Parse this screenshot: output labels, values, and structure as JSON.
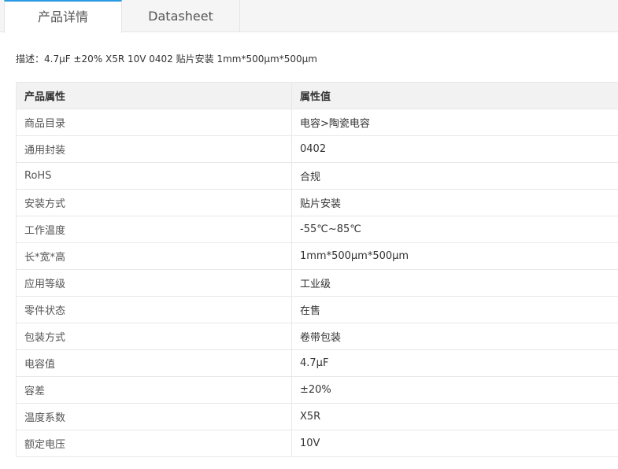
{
  "tabs": [
    {
      "label": "产品详情",
      "active": true
    },
    {
      "label": "Datasheet",
      "active": false
    }
  ],
  "description": "描述：4.7μF ±20% X5R 10V 0402 贴片安装 1mm*500μm*500μm",
  "table": {
    "headers": [
      "产品属性",
      "属性值"
    ],
    "rows": [
      [
        "商品目录",
        "电容>陶瓷电容"
      ],
      [
        "通用封装",
        "0402"
      ],
      [
        "RoHS",
        "合规"
      ],
      [
        "安装方式",
        "贴片安装"
      ],
      [
        "工作温度",
        "-55℃~85℃"
      ],
      [
        "长*宽*高",
        "1mm*500μm*500μm"
      ],
      [
        "应用等级",
        "工业级"
      ],
      [
        "零件状态",
        "在售"
      ],
      [
        "包装方式",
        "卷带包装"
      ],
      [
        "电容值",
        "4.7μF"
      ],
      [
        "容差",
        "±20%"
      ],
      [
        "温度系数",
        "X5R"
      ],
      [
        "额定电压",
        "10V"
      ]
    ]
  },
  "colors": {
    "accent": "#2a9ae3",
    "header_bg": "#f2f2f2",
    "border": "#e8e8e8"
  }
}
